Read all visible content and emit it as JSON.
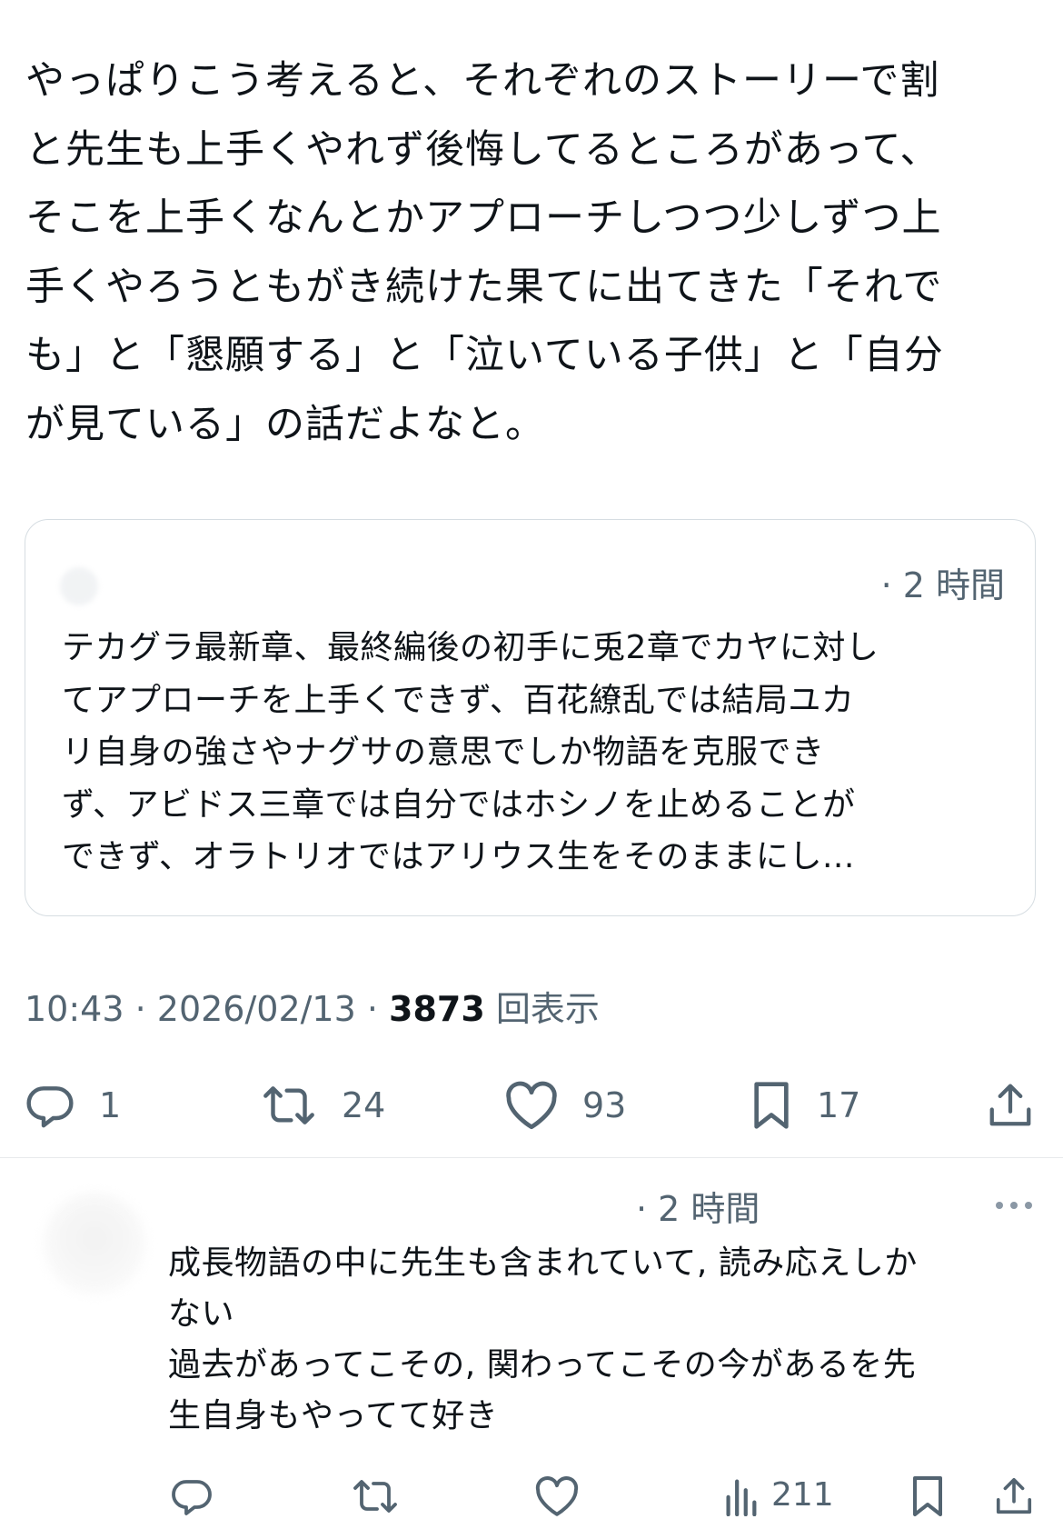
{
  "post": {
    "text": "やっぱりこう考えると、それぞれのストーリーで割\nと先生も上手くやれず後悔してるところがあって、\nそこを上手くなんとかアプローチしつつ少しずつ上\n手くやろうともがき続けた果てに出てきた「それで\nも」と「懇願する」と「泣いている子供」と「自分\nが見ている」の話だよなと。",
    "quote": {
      "time": "· 2 時間",
      "text": "テカグラ最新章、最終編後の初手に兎2章でカヤに対し\nてアプローチを上手くできず、百花繚乱では結局ユカ\nリ自身の強さやナグサの意思でしか物語を克服でき\nず、アビドス三章では自分ではホシノを止めることが\nできず、オラトリオではアリウス生をそのままにし..."
    },
    "meta": {
      "time": "10:43",
      "sep": " · ",
      "date": "2026/02/13",
      "views": "3873",
      "views_label": "回表示"
    },
    "actions": {
      "reply": "1",
      "repost": "24",
      "like": "93",
      "bookmark": "17"
    }
  },
  "reply": {
    "time": "· 2 時間",
    "text": "成長物語の中に先生も含まれていて, 読み応えしか\nない\n過去があってこその, 関わってこその今があるを先\n生自身もやってて好き",
    "views": "211"
  },
  "colors": {
    "text": "#0f1419",
    "secondary": "#536471",
    "border": "#d6dde2"
  }
}
